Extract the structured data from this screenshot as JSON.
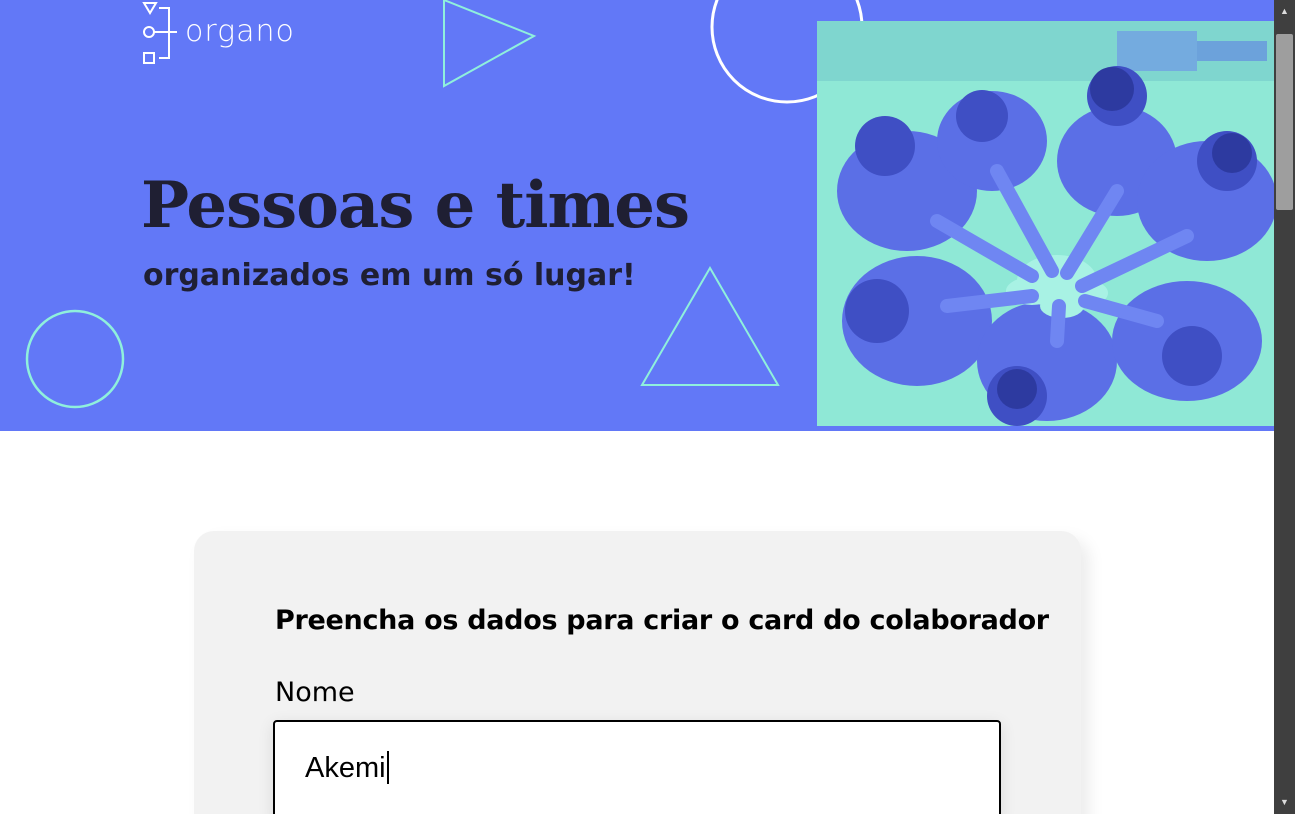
{
  "header": {
    "logo_text": "organo",
    "title": "Pessoas e times",
    "subtitle": "organizados em um só lugar!",
    "banner_color": "#6278f7",
    "accent_color": "#8ff0dc",
    "photo_icon": "team-hands-together-photo"
  },
  "form": {
    "title": "Preencha os dados para criar o card do colaborador",
    "fields": [
      {
        "label": "Nome",
        "value": "Akemi"
      }
    ]
  },
  "scrollbar": {
    "up_icon": "▲",
    "down_icon": "▼"
  }
}
